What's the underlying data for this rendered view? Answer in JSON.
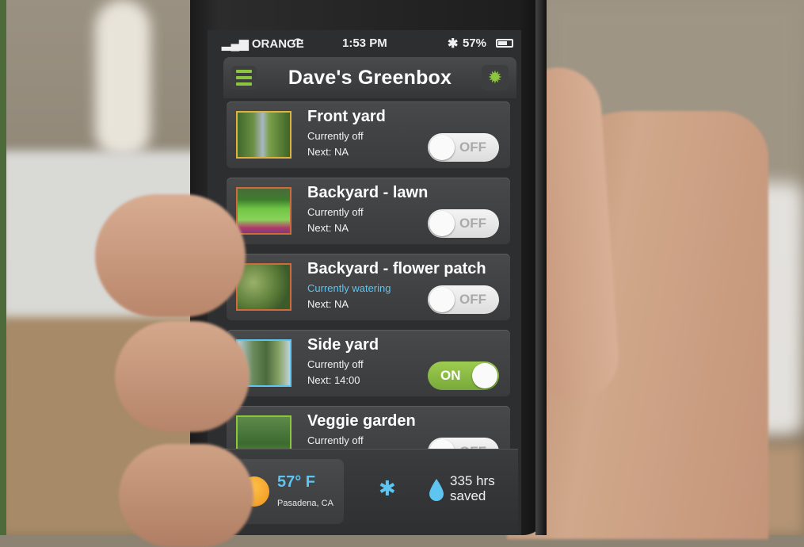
{
  "status_bar": {
    "carrier": "ORANGE",
    "time": "1:53 PM",
    "battery": "57%"
  },
  "header": {
    "title": "Dave's Greenbox"
  },
  "zones": [
    {
      "name": "Front yard",
      "status": "Currently off",
      "next": "Next: NA",
      "toggle": "OFF",
      "on": false,
      "watering": false
    },
    {
      "name": "Backyard - lawn",
      "status": "Currently off",
      "next": "Next: NA",
      "toggle": "OFF",
      "on": false,
      "watering": false
    },
    {
      "name": "Backyard - flower patch",
      "status": "Currently watering",
      "next": "Next: NA",
      "toggle": "OFF",
      "on": false,
      "watering": true
    },
    {
      "name": "Side yard",
      "status": "Currently off",
      "next": "Next: 14:00",
      "toggle": "ON",
      "on": true,
      "watering": false
    },
    {
      "name": "Veggie garden",
      "status": "Currently off",
      "next": "",
      "toggle": "OFF",
      "on": false,
      "watering": false
    }
  ],
  "footer": {
    "temperature": "57° F",
    "location": "Pasadena, CA",
    "saved_value": "335 hrs",
    "saved_label": "saved"
  },
  "colors": {
    "accent_green": "#8cc63f",
    "accent_blue": "#5ec5f0",
    "panel": "#3a3b3d"
  },
  "icons": {
    "menu": "menu-icon",
    "settings": "gear-icon",
    "weather": "sun-icon",
    "bluetooth": "bluetooth-icon",
    "water": "water-drop-icon"
  }
}
